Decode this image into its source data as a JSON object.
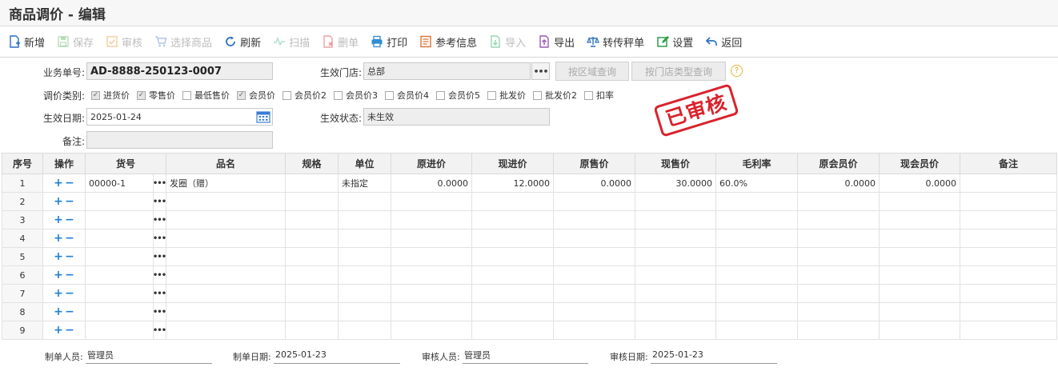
{
  "window": {
    "title": "商品调价 - 编辑"
  },
  "toolbar": [
    {
      "label": "新增",
      "icon": "add-doc-icon",
      "enabled": true,
      "color": "#2f6fc6"
    },
    {
      "label": "保存",
      "icon": "save-icon",
      "enabled": false,
      "color": "#7bc27b"
    },
    {
      "label": "审核",
      "icon": "check-icon",
      "enabled": false,
      "color": "#e8a24a"
    },
    {
      "label": "选择商品",
      "icon": "cart-icon",
      "enabled": false,
      "color": "#6a8fd0"
    },
    {
      "label": "刷新",
      "icon": "refresh-icon",
      "enabled": true,
      "color": "#2f6fc6"
    },
    {
      "label": "扫描",
      "icon": "scan-icon",
      "enabled": false,
      "color": "#6cc3a0"
    },
    {
      "label": "删单",
      "icon": "delete-doc-icon",
      "enabled": false,
      "color": "#e05050"
    },
    {
      "label": "打印",
      "icon": "print-icon",
      "enabled": true,
      "color": "#2f8fd6"
    },
    {
      "label": "参考信息",
      "icon": "reference-icon",
      "enabled": true,
      "color": "#e07030"
    },
    {
      "label": "导入",
      "icon": "import-icon",
      "enabled": false,
      "color": "#3cb371"
    },
    {
      "label": "导出",
      "icon": "export-icon",
      "enabled": true,
      "color": "#9b59b6"
    },
    {
      "label": "转传秤单",
      "icon": "scale-icon",
      "enabled": true,
      "color": "#2f6fc6"
    },
    {
      "label": "设置",
      "icon": "settings-icon",
      "enabled": true,
      "color": "#2e9e4a"
    },
    {
      "label": "返回",
      "icon": "back-icon",
      "enabled": true,
      "color": "#2f6fc6"
    }
  ],
  "form": {
    "doc_no_label": "业务单号:",
    "doc_no": "AD-8888-250123-0007",
    "store_label": "生效门店:",
    "store": "总部",
    "btn_by_region": "按区域查询",
    "btn_by_store_type": "按门店类型查询",
    "help": "?",
    "adjust_type_label": "调价类别:",
    "adjust_types": [
      {
        "label": "进货价",
        "checked": true
      },
      {
        "label": "零售价",
        "checked": true
      },
      {
        "label": "最低售价",
        "checked": false
      },
      {
        "label": "会员价",
        "checked": true
      },
      {
        "label": "会员价2",
        "checked": false
      },
      {
        "label": "会员价3",
        "checked": false
      },
      {
        "label": "会员价4",
        "checked": false
      },
      {
        "label": "会员价5",
        "checked": false
      },
      {
        "label": "批发价",
        "checked": false
      },
      {
        "label": "批发价2",
        "checked": false
      },
      {
        "label": "扣率",
        "checked": false
      }
    ],
    "eff_date_label": "生效日期:",
    "eff_date": "2025-01-24",
    "eff_status_label": "生效状态:",
    "eff_status": "未生效",
    "remark_label": "备注:",
    "remark": ""
  },
  "stamp": {
    "text": "已审核",
    "color": "#d9232d"
  },
  "table": {
    "headers": [
      "序号",
      "操作",
      "货号",
      "品名",
      "规格",
      "单位",
      "原进价",
      "现进价",
      "原售价",
      "现售价",
      "毛利率",
      "原会员价",
      "现会员价",
      "备注"
    ],
    "rows": [
      {
        "seq": "1",
        "code": "00000-1",
        "name": "发圈（赠）",
        "spec": "",
        "unit": "未指定",
        "old_cost": "0.0000",
        "new_cost": "12.0000",
        "old_price": "0.0000",
        "new_price": "30.0000",
        "margin": "60.0%",
        "old_member": "0.0000",
        "new_member": "0.0000",
        "remark": ""
      },
      {
        "seq": "2",
        "code": "",
        "name": "",
        "spec": "",
        "unit": "",
        "old_cost": "",
        "new_cost": "",
        "old_price": "",
        "new_price": "",
        "margin": "",
        "old_member": "",
        "new_member": "",
        "remark": ""
      },
      {
        "seq": "3",
        "code": "",
        "name": "",
        "spec": "",
        "unit": "",
        "old_cost": "",
        "new_cost": "",
        "old_price": "",
        "new_price": "",
        "margin": "",
        "old_member": "",
        "new_member": "",
        "remark": ""
      },
      {
        "seq": "4",
        "code": "",
        "name": "",
        "spec": "",
        "unit": "",
        "old_cost": "",
        "new_cost": "",
        "old_price": "",
        "new_price": "",
        "margin": "",
        "old_member": "",
        "new_member": "",
        "remark": ""
      },
      {
        "seq": "5",
        "code": "",
        "name": "",
        "spec": "",
        "unit": "",
        "old_cost": "",
        "new_cost": "",
        "old_price": "",
        "new_price": "",
        "margin": "",
        "old_member": "",
        "new_member": "",
        "remark": ""
      },
      {
        "seq": "6",
        "code": "",
        "name": "",
        "spec": "",
        "unit": "",
        "old_cost": "",
        "new_cost": "",
        "old_price": "",
        "new_price": "",
        "margin": "",
        "old_member": "",
        "new_member": "",
        "remark": ""
      },
      {
        "seq": "7",
        "code": "",
        "name": "",
        "spec": "",
        "unit": "",
        "old_cost": "",
        "new_cost": "",
        "old_price": "",
        "new_price": "",
        "margin": "",
        "old_member": "",
        "new_member": "",
        "remark": ""
      },
      {
        "seq": "8",
        "code": "",
        "name": "",
        "spec": "",
        "unit": "",
        "old_cost": "",
        "new_cost": "",
        "old_price": "",
        "new_price": "",
        "margin": "",
        "old_member": "",
        "new_member": "",
        "remark": ""
      },
      {
        "seq": "9",
        "code": "",
        "name": "",
        "spec": "",
        "unit": "",
        "old_cost": "",
        "new_cost": "",
        "old_price": "",
        "new_price": "",
        "margin": "",
        "old_member": "",
        "new_member": "",
        "remark": ""
      }
    ],
    "op_add": "+",
    "op_remove": "−",
    "dots": "•••"
  },
  "footer": {
    "maker_label": "制单人员:",
    "maker": "管理员",
    "make_date_label": "制单日期:",
    "make_date": "2025-01-23",
    "auditor_label": "审核人员:",
    "auditor": "管理员",
    "audit_date_label": "审核日期:",
    "audit_date": "2025-01-23"
  }
}
